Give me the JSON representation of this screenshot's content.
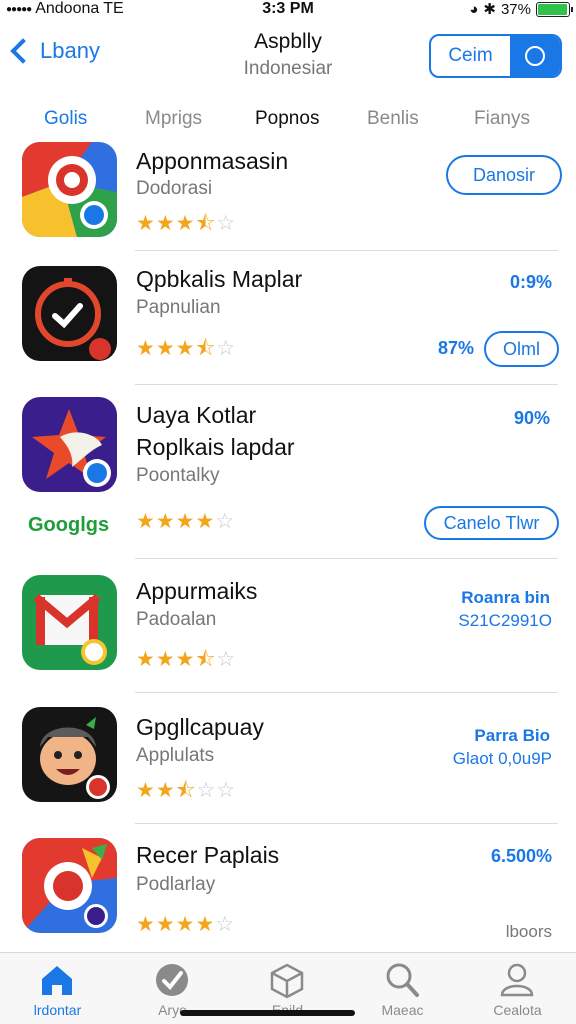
{
  "status_bar": {
    "carrier": "Andoona",
    "network": "TE",
    "time": "3:3 PM",
    "battery_text": "37%",
    "battery_level": 0.95,
    "battery_color": "#31c24a"
  },
  "nav": {
    "back_label": "Lbany",
    "title": "Aspblly",
    "subtitle": "Indonesiar",
    "segment_label": "Ceim",
    "accent": "#1a78e6"
  },
  "tabs": [
    "Golis",
    "Mprigs",
    "Popnos",
    "Benlis",
    "Fianys"
  ],
  "apps": [
    {
      "name": "Apponmasasin",
      "subtitle": "Dodorasi",
      "rating": 3.5,
      "action": "Danosir"
    },
    {
      "name": "Qpbkalis Maplar",
      "subtitle": "Papnulian",
      "rating": 3.5,
      "percent": "0:9%",
      "percent2": "87%",
      "action": "Olml"
    },
    {
      "name": "Uaya Kotlar",
      "name2": "Roplkais lapdar",
      "subtitle": "Poontalky",
      "rating": 4,
      "percent": "90%",
      "side_label": "Googlgs",
      "action": "Canelo Tlwr"
    },
    {
      "name": "Appurmaiks",
      "subtitle": "Padoalan",
      "rating": 3.5,
      "price_line1": "Roanra bin",
      "price_line2": "S21C2991O"
    },
    {
      "name": "Gpgllcapuay",
      "subtitle": "Applulats",
      "rating": 2.5,
      "price_line1": "Parra Bio",
      "price_line2": "Glaot 0,0u9P"
    },
    {
      "name": "Recer Paplais",
      "subtitle": "Podlarlay",
      "rating": 4,
      "percent": "6.500%",
      "footer_text": "lboors"
    }
  ],
  "tab_bar": [
    {
      "label": "lrdontar",
      "icon": "house-icon",
      "active": true
    },
    {
      "label": "Arye",
      "icon": "check-badge-icon",
      "active": false
    },
    {
      "label": "Enild",
      "icon": "box-icon",
      "active": false
    },
    {
      "label": "Maeac",
      "icon": "search-icon",
      "active": false
    },
    {
      "label": "Cealota",
      "icon": "person-icon",
      "active": false
    }
  ]
}
